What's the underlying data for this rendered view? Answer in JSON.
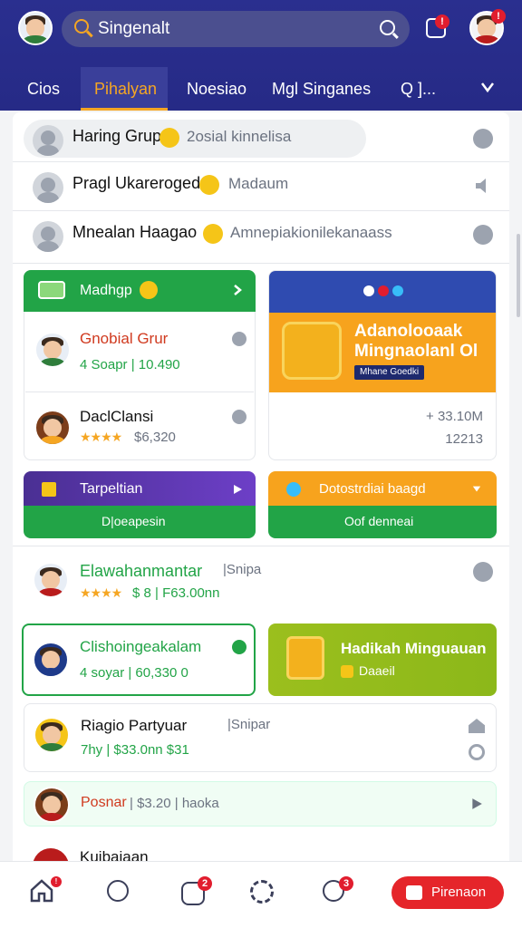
{
  "header": {
    "search_text": "Singenalt",
    "tabs": [
      "Cios",
      "Pihalyan",
      "Noesiao",
      "Mgl Singanes",
      "Q ]..."
    ],
    "active_tab_index": 1,
    "notif_badge": "!",
    "avatar_badge": "!"
  },
  "list": [
    {
      "name": "Haring Grup",
      "sub": "2osial kinnelisa"
    },
    {
      "name": "Pragl Ukareroged",
      "sub": "Madaum"
    },
    {
      "name": "Mnealan Haagao",
      "sub": "Amnepiakionilekanaass"
    }
  ],
  "panel_left": {
    "header": "Madhgp",
    "rows": [
      {
        "name": "Gnobial Grur",
        "meta": "4 Soapr | 10.490"
      },
      {
        "name": "DaclClansi",
        "meta": "$6,320",
        "stars": "★★★★"
      }
    ]
  },
  "promo": {
    "title_line1": "Adanolooaak",
    "title_line2": "Mingnaolanl Ol",
    "tag": "Mhane Goedki",
    "price1": "+ 33.10M",
    "price2": "12213"
  },
  "bars": {
    "left_top": "Tarpeltian",
    "left_bottom": "D|oeapesin",
    "right_top": "Dotostrdiai baagd",
    "right_bottom": "Oof denneai"
  },
  "rows2": [
    {
      "name": "Elawahanmantar",
      "tag": "|Snipa",
      "meta": "$ 8 | F63.00nn",
      "stars": "★★★★"
    },
    {
      "name": "Clishoingeakalam",
      "meta": "4 soyar | 60,330 0"
    },
    {
      "name": "Riagio Partyuar",
      "tag": "|Snipar",
      "meta": "7hy | $33.0nn   $31"
    },
    {
      "name": "Posnar",
      "meta": "| $3.20  | haoka"
    },
    {
      "name": "Kuibaiaan"
    }
  ],
  "promo2": {
    "title": "Hadikah Minguauan",
    "sub": "Daaeil"
  },
  "nav": {
    "cta": "Pirenaon",
    "badge1": "!",
    "badge2": "2",
    "badge3": "3"
  }
}
